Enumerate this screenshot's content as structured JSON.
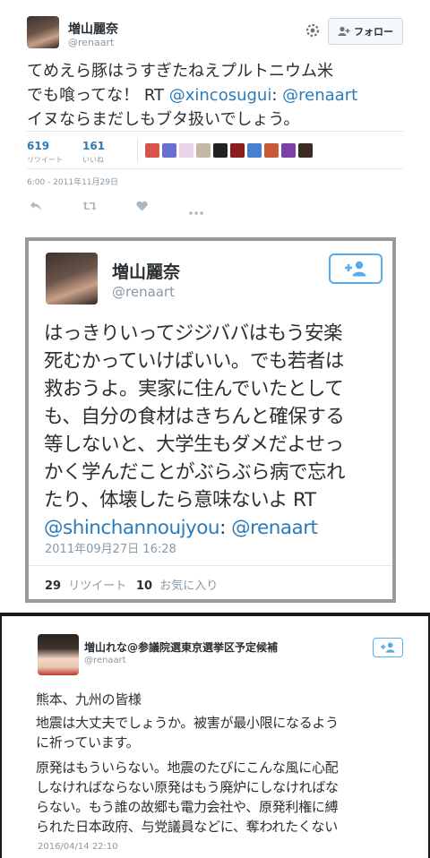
{
  "tweet1": {
    "name": "増山麗奈",
    "handle": "@renaart",
    "follow_label": "フォロー",
    "text_l1": "てめえら豚はうすぎたねえプルトニウム米",
    "text_l2": "でも喰ってな！ RT ",
    "mention1": "@xincosugui",
    "colon": ": ",
    "mention2": "@renaart",
    "text_l3": "イヌならまだしもブタ扱いでしょう。",
    "retweet_count": "619",
    "retweet_label": "リツイート",
    "like_count": "161",
    "like_label": "いいね",
    "timestamp": "6:00 - 2011年11月29日",
    "likers": [
      "#d9534f",
      "#6a6fd1",
      "#e9d3ea",
      "#c6b8a8",
      "#222222",
      "#8c1c1c",
      "#4a7fd0",
      "#c85a3a",
      "#7e3fa6",
      "#3b2b22"
    ]
  },
  "tweet2": {
    "name": "増山麗奈",
    "handle": "@renaart",
    "lines": [
      "はっきりいってジジババはもう安楽",
      "死むかっていけばいい。でも若者は",
      "救おうよ。実家に住んでいたとして",
      "も、自分の食材はきちんと確保する",
      "等しないと、大学生もダメだよせっ",
      "かく学んだことがぶらぶら病で忘れ"
    ],
    "line7": "たり、体壊したら意味ないよ RT",
    "mention1": "@shinchannoujyou",
    "colon": ": ",
    "mention2": "@renaart",
    "timestamp": "2011年09月27日 16:28",
    "retweet_count": "29",
    "retweet_label": "リツイート",
    "fav_count": "10",
    "fav_label": "お気に入り"
  },
  "tweet3": {
    "name": "増山れな@参議院選東京選挙区予定候補",
    "handle": "@renaart",
    "lines": [
      "熊本、九州の皆様",
      "地震は大丈夫でしょうか。被害が最小限になるよう",
      "に祈っています。",
      "原発はもういらない。地震のたびにこんな風に心配",
      "しなければならない原発はもう廃炉にしなければな",
      "らない。もう誰の故郷も電力会社や、原発利権に縛",
      "られた日本政府、与党議員などに、奪われたくない"
    ],
    "timestamp": "2016/04/14 22:10"
  }
}
